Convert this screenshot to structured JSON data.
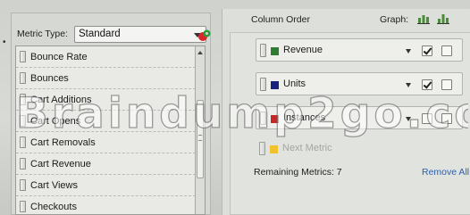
{
  "metric_selector": {
    "metric_type_label": "Metric Type:",
    "metric_type_value": "Standard",
    "items": [
      {
        "label": "Bounce Rate"
      },
      {
        "label": "Bounces"
      },
      {
        "label": "Cart Additions"
      },
      {
        "label": "Cart Opens"
      },
      {
        "label": "Cart Removals"
      },
      {
        "label": "Cart Revenue"
      },
      {
        "label": "Cart Views"
      },
      {
        "label": "Checkouts"
      }
    ]
  },
  "column_order": {
    "header": "Column Order",
    "graph_label": "Graph:",
    "slots": [
      {
        "label": "Revenue",
        "color": "#2e7d32",
        "graph_checked": true,
        "second_checked": false
      },
      {
        "label": "Units",
        "color": "#1a237e",
        "graph_checked": true,
        "second_checked": false
      },
      {
        "label": "Instances",
        "color": "#c62828",
        "graph_checked": false,
        "second_checked": false
      }
    ],
    "next_metric_label": "Next Metric",
    "next_metric_color": "#f2c12e",
    "remaining_text": "Remaining Metrics: 7",
    "remove_all_label": "Remove All"
  },
  "watermark": {
    "text": "Braindump2go.com"
  }
}
